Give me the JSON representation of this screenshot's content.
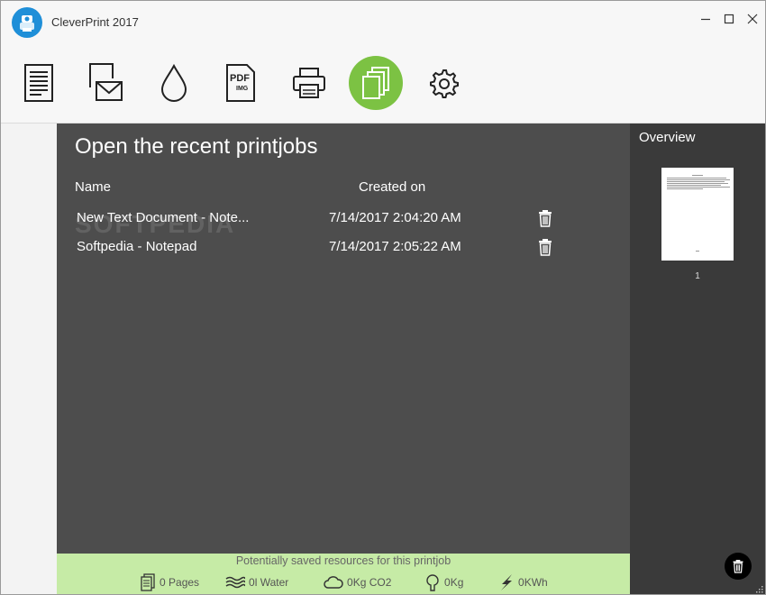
{
  "window": {
    "title": "CleverPrint 2017"
  },
  "toolbar": {
    "tools": [
      {
        "name": "document"
      },
      {
        "name": "email"
      },
      {
        "name": "ink"
      },
      {
        "name": "pdf-img",
        "label_top": "PDF",
        "label_bottom": "IMG"
      },
      {
        "name": "print"
      },
      {
        "name": "printjobs",
        "active": true
      },
      {
        "name": "settings"
      }
    ]
  },
  "main": {
    "title": "Open the recent printjobs",
    "columns": {
      "name": "Name",
      "created": "Created on"
    },
    "rows": [
      {
        "name": "New Text Document - Note...",
        "created": "7/14/2017 2:04:20 AM"
      },
      {
        "name": "Softpedia - Notepad",
        "created": "7/14/2017 2:05:22 AM"
      }
    ],
    "watermark": "SOFTPEDIA"
  },
  "footer": {
    "title": "Potentially saved resources for this printjob",
    "pages_value": "0",
    "pages_unit": "Pages",
    "water_value": "0",
    "water_unit": "l Water",
    "co2_value": "0",
    "co2_unit": "Kg CO2",
    "wood_value": "0",
    "wood_unit": "Kg",
    "energy_value": "0",
    "energy_unit": "KWh"
  },
  "overview": {
    "title": "Overview",
    "page_number": "1"
  },
  "colors": {
    "accent_green": "#7cc243",
    "footer_bg": "#c6eba6",
    "main_bg": "#4d4d4d",
    "overview_bg": "#3a3a3a",
    "logo_blue": "#1f8fd8"
  }
}
